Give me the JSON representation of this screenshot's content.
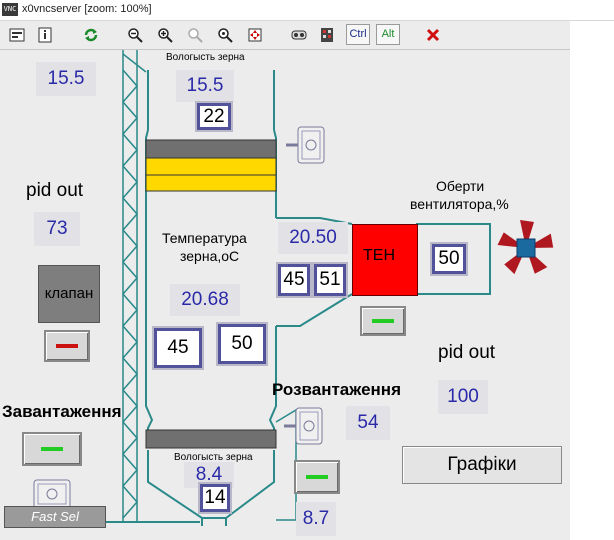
{
  "window": {
    "title": "x0vncserver [zoom: 100%]",
    "icon_text": "VNC"
  },
  "toolbar": {
    "buttons": [
      {
        "name": "options-icon"
      },
      {
        "name": "connection-info-icon"
      },
      {
        "name": "refresh-icon"
      },
      {
        "name": "zoom-out-icon"
      },
      {
        "name": "zoom-in-icon"
      },
      {
        "name": "zoom-100-icon"
      },
      {
        "name": "zoom-fit-icon"
      },
      {
        "name": "fullscreen-icon"
      },
      {
        "name": "ctrl-alt-del-icon"
      },
      {
        "name": "send-keys-icon"
      }
    ],
    "ctrl_label": "Ctrl",
    "alt_label": "Alt"
  },
  "hmi": {
    "left_value": "15.5",
    "pid_left": {
      "label": "pid out",
      "value": "73"
    },
    "valve": {
      "label": "клапан"
    },
    "loading": {
      "label": "Завантаження"
    },
    "fast_sel": "Fast Sel",
    "top_moisture": {
      "label": "Вологысть зерна",
      "value": "15.5",
      "setpoint": "22"
    },
    "temperature": {
      "label_line1": "Температура",
      "label_line2": "зерна,оС",
      "value": "20.68",
      "box1": "45",
      "box2": "50"
    },
    "duct": {
      "value": "20.50",
      "box1": "45",
      "box2": "51"
    },
    "heater": {
      "label": "ТЕН",
      "box": "50"
    },
    "fan": {
      "label_line1": "Оберти",
      "label_line2": "вентилятора,%"
    },
    "pid_right": {
      "label": "pid out",
      "value": "100"
    },
    "unloading": {
      "label": "Розвантаження",
      "value": "54"
    },
    "bottom_moisture": {
      "label": "Вологысть зерна",
      "value": "8.4",
      "setpoint": "14"
    },
    "bottom_right_value": "8.7",
    "graphs_button": "Графіки"
  },
  "colors": {
    "pipe": "#2a8a8a",
    "value_text": "#2a2aa8",
    "heater": "#ff0000",
    "fan": "#b01820",
    "yellow": "#ffd800",
    "grey_band": "#707070",
    "led_green": "#22cc22",
    "led_red": "#cc1111"
  }
}
